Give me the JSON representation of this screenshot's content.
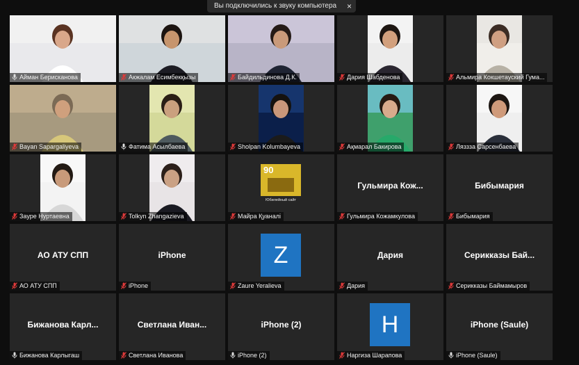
{
  "notification": {
    "text": "Вы подключились к звуку компьютера",
    "close": "×"
  },
  "participants": [
    {
      "name": "Айман Берисканова",
      "muted": false,
      "kind": "video"
    },
    {
      "name": "Акжалам Есимбекқызы",
      "muted": true,
      "kind": "video"
    },
    {
      "name": "Байдильдинова Д.К.",
      "muted": true,
      "kind": "video"
    },
    {
      "name": "Дария Шабденова",
      "muted": true,
      "kind": "video"
    },
    {
      "name": "Альмира Кокшетауский Гума...",
      "muted": true,
      "kind": "video"
    },
    {
      "name": "Bayan Sapargaliyeva",
      "muted": true,
      "kind": "video"
    },
    {
      "name": "Фатима Асылбаева",
      "muted": false,
      "kind": "video",
      "active": true
    },
    {
      "name": "Sholpan Kolumbayeva",
      "muted": true,
      "kind": "video"
    },
    {
      "name": "Ақмарал Бакирова",
      "muted": true,
      "kind": "video"
    },
    {
      "name": "Ляззза Сарсенбаева",
      "muted": true,
      "kind": "video"
    },
    {
      "name": "Зауре Нуртаевна",
      "muted": true,
      "kind": "video"
    },
    {
      "name": "Tolkyn Zhangazieva",
      "muted": true,
      "kind": "video"
    },
    {
      "name": "Майра Қуаналі",
      "muted": true,
      "kind": "logo",
      "logo_number": "90",
      "logo_caption": "Юбилейный сайт"
    },
    {
      "name": "Гульмира Кожамкулова",
      "muted": true,
      "kind": "name",
      "display": "Гульмира Кож..."
    },
    {
      "name": "Бибымария",
      "muted": true,
      "kind": "name",
      "display": "Бибымария"
    },
    {
      "name": "АО АТУ СПП",
      "muted": true,
      "kind": "name",
      "display": "АО АТУ СПП"
    },
    {
      "name": "iPhone",
      "muted": true,
      "kind": "name",
      "display": "iPhone"
    },
    {
      "name": "Zaure Yeralieva",
      "muted": true,
      "kind": "letter",
      "letter": "Z"
    },
    {
      "name": "Дария",
      "muted": true,
      "kind": "name",
      "display": "Дария"
    },
    {
      "name": "Серикказы Баймамыров",
      "muted": true,
      "kind": "name",
      "display": "Серикказы Бай..."
    },
    {
      "name": "Бижанова Карлыгаш",
      "muted": false,
      "kind": "name",
      "display": "Бижанова Карл..."
    },
    {
      "name": "Светлана Иванова",
      "muted": true,
      "kind": "name",
      "display": "Светлана Иван..."
    },
    {
      "name": "iPhone (2)",
      "muted": false,
      "kind": "name",
      "display": "iPhone (2)"
    },
    {
      "name": "Наргиза Шарапова",
      "muted": true,
      "kind": "letter",
      "letter": "H"
    },
    {
      "name": "iPhone (Saule)",
      "muted": false,
      "kind": "name",
      "display": "iPhone (Saule)"
    }
  ],
  "colors": {
    "tile_bg": "#262626",
    "letter_avatar": "#1f74c2",
    "mic_muted": "#e03a3a",
    "active_border": "#c8d86a"
  }
}
